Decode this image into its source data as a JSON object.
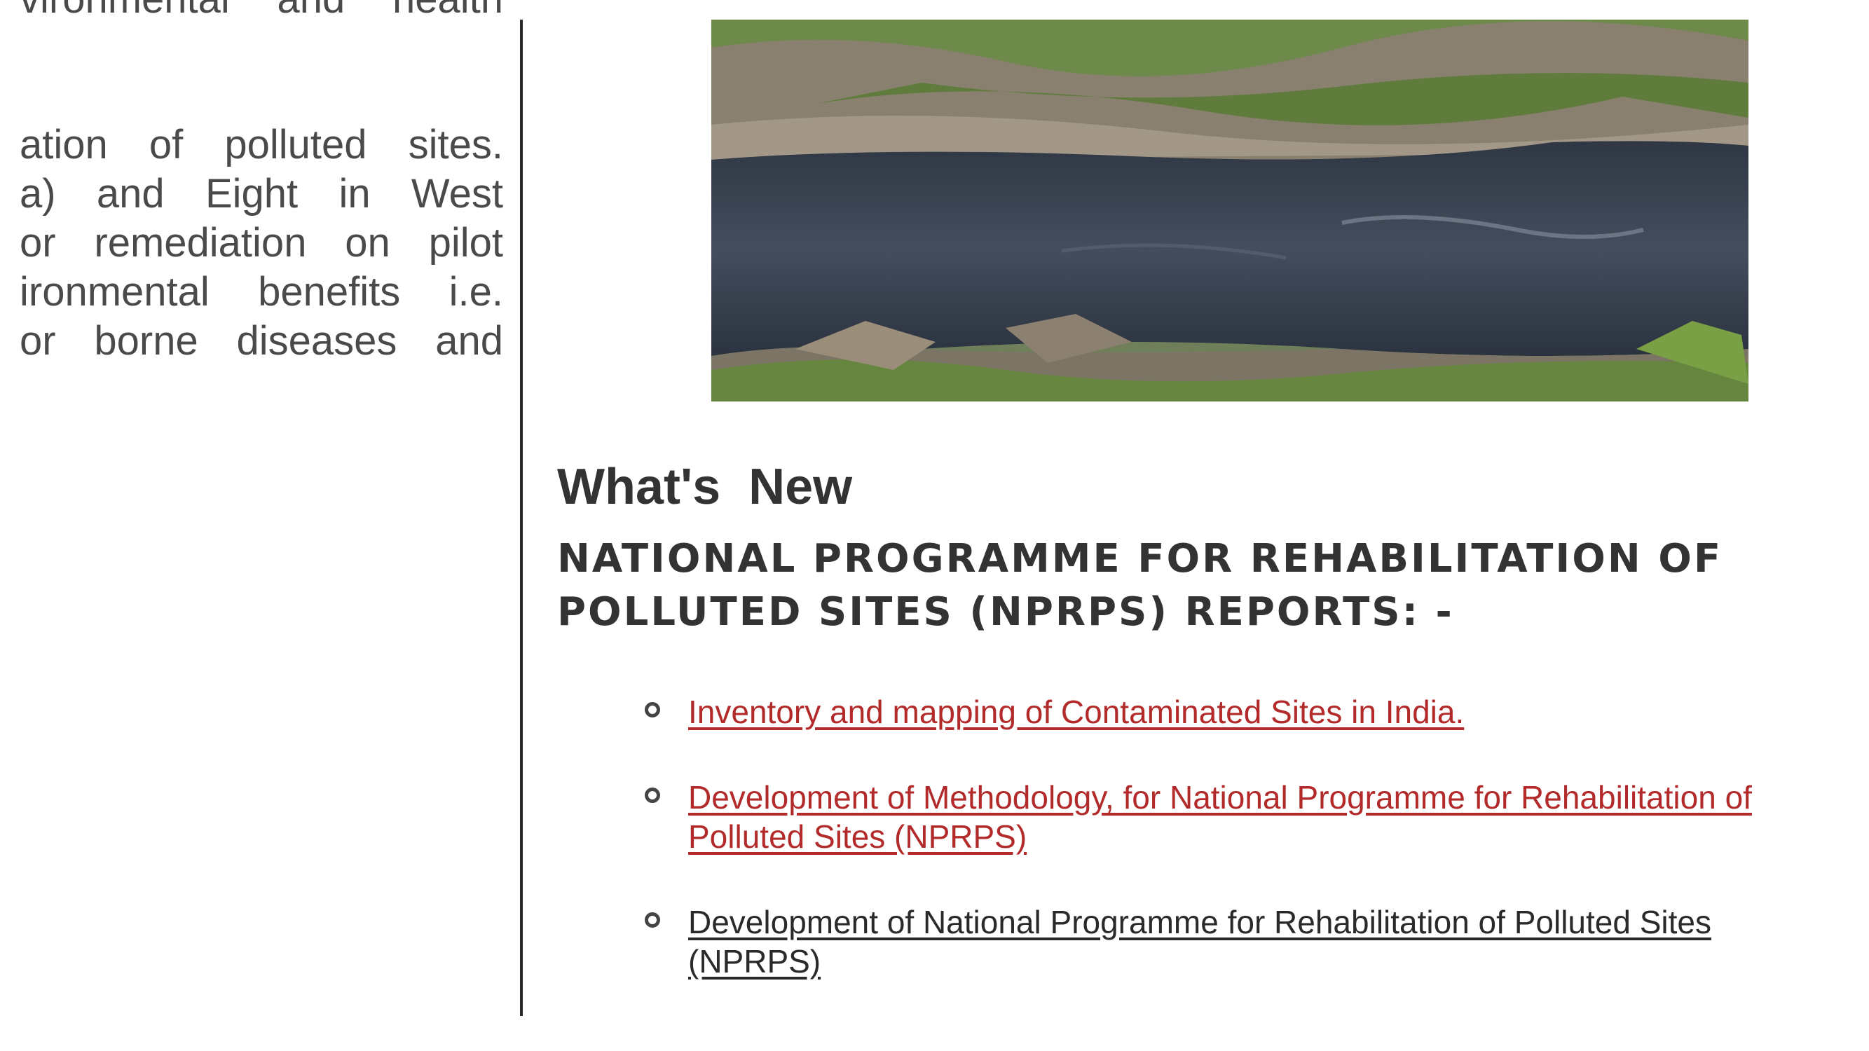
{
  "left_column": {
    "lines": [
      "vironmental and health",
      "ation of polluted sites.",
      "a) and Eight in West",
      "or remediation on pilot",
      "ironmental benefits i.e.",
      "or borne diseases and"
    ]
  },
  "whats_new": {
    "title": "What's  New",
    "heading": "NATIONAL PROGRAMME FOR REHABILITATION OF POLLUTED SITES (NPRPS) REPORTS: -",
    "reports": [
      {
        "label": "Inventory and mapping of Contaminated Sites in India.",
        "color": "#b22a2a"
      },
      {
        "label": "Development of Methodology, for National Programme for Rehabilitation of Polluted Sites (NPRPS)",
        "color": "#b22a2a"
      },
      {
        "label": "Development of National Programme for Rehabilitation of Polluted Sites (NPRPS)",
        "color": "#2a2a2a"
      }
    ]
  },
  "colors": {
    "text": "#333333",
    "link_visited": "#b22a2a",
    "link": "#2a2a2a",
    "divider": "#2a2a2a",
    "water": "#3c4452"
  }
}
